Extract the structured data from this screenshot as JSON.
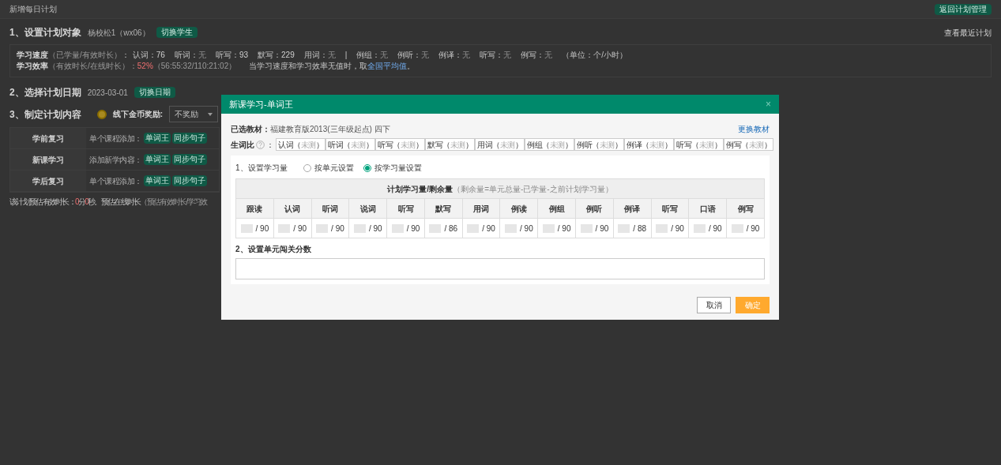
{
  "page": {
    "title": "新增每日计划",
    "back_button": "返回计划管理"
  },
  "section1": {
    "title": "1、设置计划对象",
    "student": "杨校松1（wx06）",
    "switch_button": "切换学生",
    "recent_link": "查看最近计划"
  },
  "speed": {
    "title": "学习速度",
    "hint": "（已学量/有效时长）",
    "colon": "：",
    "items": [
      {
        "kind": "stat",
        "label": "认词：",
        "value": "76",
        "empty": false
      },
      {
        "kind": "stat",
        "label": "听词：",
        "value": "无",
        "empty": true
      },
      {
        "kind": "stat",
        "label": "听写：",
        "value": "93",
        "empty": false
      },
      {
        "kind": "stat",
        "label": "默写：",
        "value": "229",
        "empty": false
      },
      {
        "kind": "stat",
        "label": "用词：",
        "value": "无",
        "empty": true
      },
      {
        "kind": "divider",
        "label": "|"
      },
      {
        "kind": "stat",
        "label": "例组：",
        "value": "无",
        "empty": true
      },
      {
        "kind": "stat",
        "label": "例听：",
        "value": "无",
        "empty": true
      },
      {
        "kind": "stat",
        "label": "例译：",
        "value": "无",
        "empty": true
      },
      {
        "kind": "stat",
        "label": "听写：",
        "value": "无",
        "empty": true
      },
      {
        "kind": "stat",
        "label": "例写：",
        "value": "无",
        "empty": true
      }
    ],
    "unit": "（单位：个/小时）"
  },
  "efficiency": {
    "title": "学习效率",
    "hint": "（有效时长/在线时长）：",
    "value": "52%",
    "detail": "（56:55:32/110:21:02）",
    "note": "当学习速度和学习效率无值时，取",
    "link": "全国平均值",
    "end": "。"
  },
  "section2": {
    "title": "2、选择计划日期",
    "date": "2023-03-01",
    "switch_button": "切换日期"
  },
  "section3": {
    "title": "3、制定计划内容",
    "reward_label": "线下金币奖励:",
    "reward_value": "不奖励"
  },
  "plan_rows": [
    {
      "label": "学前复习",
      "add_label": "单个课程添加：",
      "buttons": [
        "单词王",
        "同步句子"
      ]
    },
    {
      "label": "新课学习",
      "add_label": "添加新学内容：",
      "buttons": [
        "单词王",
        "同步句子"
      ]
    },
    {
      "label": "学后复习",
      "add_label": "单个课程添加：",
      "buttons": [
        "单词王",
        "同步句子"
      ]
    }
  ],
  "footer": {
    "label": "该计划预估有效时长：",
    "minutes": "0",
    "min_unit": "分",
    "seconds": "0",
    "sec_unit": "秒。预估在线时长",
    "hint": "（预估有效时长/学习效"
  },
  "dialog": {
    "title": "新课学习-单词王",
    "close": "×",
    "textbook_label": "已选教材：",
    "textbook": "福建教育版2013(三年级起点) 四下",
    "change_link": "更换教材",
    "ratio_label": "生词比",
    "ratio_colon": "：",
    "ratios": [
      {
        "name": "认词（",
        "value": "未测",
        "close": "）"
      },
      {
        "name": "听词（",
        "value": "未测",
        "close": "）"
      },
      {
        "name": "听写（",
        "value": "未测",
        "close": "）"
      },
      {
        "name": "默写（",
        "value": "未测",
        "close": "）"
      },
      {
        "name": "用词（",
        "value": "未测",
        "close": "）"
      },
      {
        "name": "例组（",
        "value": "未测",
        "close": "）"
      },
      {
        "name": "例听（",
        "value": "未测",
        "close": "）"
      },
      {
        "name": "例译（",
        "value": "未测",
        "close": "）"
      },
      {
        "name": "听写（",
        "value": "未测",
        "close": "）"
      },
      {
        "name": "例写（",
        "value": "未测",
        "close": "）"
      }
    ],
    "step1": "1、设置学习量",
    "options": [
      {
        "label": "按单元设置",
        "selected": false
      },
      {
        "label": "按学习量设置",
        "selected": true
      }
    ],
    "table_title": "计划学习量/剩余量",
    "table_hint": "（剩余量=单元总量-已学量-之前计划学习量）",
    "columns": [
      {
        "header": "跟读",
        "remaining": "/ 90"
      },
      {
        "header": "认词",
        "remaining": "/ 90"
      },
      {
        "header": "听词",
        "remaining": "/ 90"
      },
      {
        "header": "说词",
        "remaining": "/ 90"
      },
      {
        "header": "听写",
        "remaining": "/ 90"
      },
      {
        "header": "默写",
        "remaining": "/ 86"
      },
      {
        "header": "用词",
        "remaining": "/ 90"
      },
      {
        "header": "例读",
        "remaining": "/ 90"
      },
      {
        "header": "例组",
        "remaining": "/ 90"
      },
      {
        "header": "例听",
        "remaining": "/ 90"
      },
      {
        "header": "例译",
        "remaining": "/ 88"
      },
      {
        "header": "听写",
        "remaining": "/ 90"
      },
      {
        "header": "口语",
        "remaining": "/ 90"
      },
      {
        "header": "例写",
        "remaining": "/ 90"
      }
    ],
    "step2": "2、设置单元闯关分数",
    "cancel": "取消",
    "confirm": "确定"
  }
}
